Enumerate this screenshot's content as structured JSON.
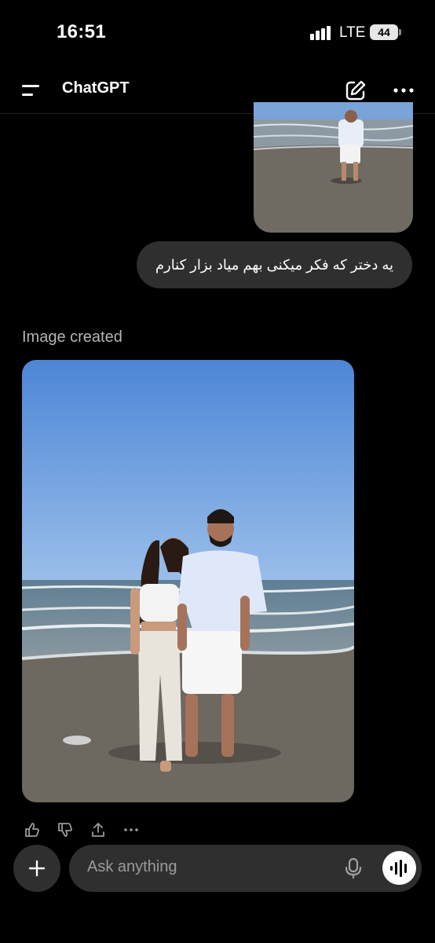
{
  "status_bar": {
    "time": "16:51",
    "network": "LTE",
    "battery": "44"
  },
  "header": {
    "title": "ChatGPT"
  },
  "messages": {
    "user_text": "یه دختر که فکر میکنی بهم میاد بزار کنارم",
    "assistant_status": "Image created"
  },
  "composer": {
    "placeholder": "Ask anything"
  },
  "colors": {
    "background": "#000000",
    "bubble": "#2f2f2f",
    "muted_text": "#b4b4b4",
    "sky": "#5b8fd6",
    "sand": "#6f6a62"
  }
}
